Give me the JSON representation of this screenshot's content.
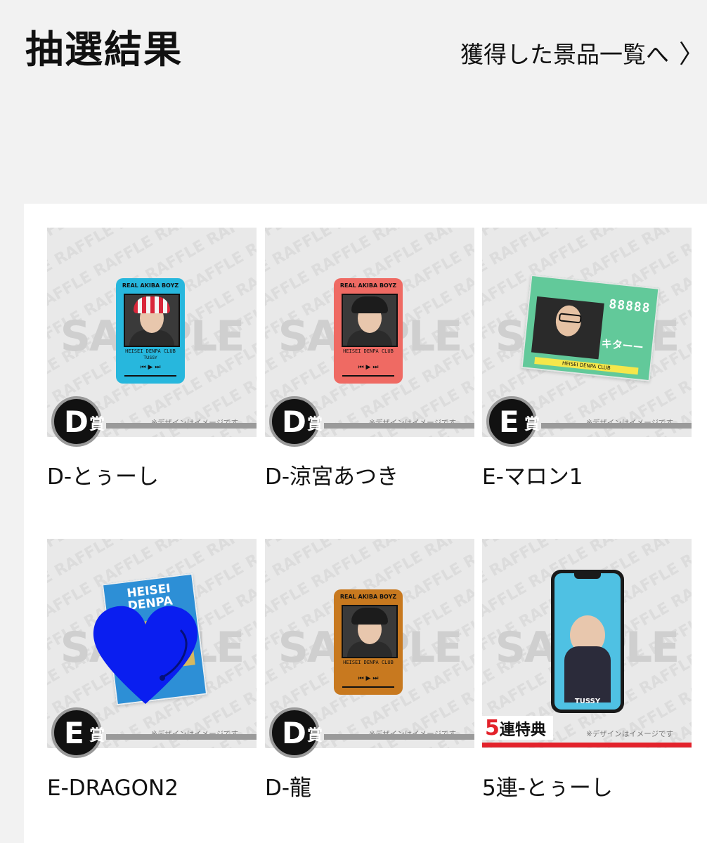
{
  "header": {
    "title": "抽選結果",
    "prizes_link": "獲得した景品一覧へ",
    "chevron_glyph": "〉"
  },
  "watermark": {
    "sample": "SAMPLE",
    "raffle": "RAFFLE"
  },
  "caution_text": "※デザインはイメージです",
  "prize_suffix": "賞",
  "items": [
    {
      "label": "D-とぅーし",
      "grade": "D",
      "product": "phone",
      "color": "#27b7dd",
      "hat": "#e8e8f0"
    },
    {
      "label": "D-涼宮あつき",
      "grade": "D",
      "product": "phone",
      "color": "#ef6a63",
      "hat": "#1c1c1c"
    },
    {
      "label": "E-マロン1",
      "grade": "E",
      "product": "ticket",
      "color": "#62c99a"
    },
    {
      "label": "E-DRAGON2",
      "grade": "E",
      "product": "book",
      "color": "#2d8fd6"
    },
    {
      "label": "D-龍",
      "grade": "D",
      "product": "phone",
      "color": "#c8791f",
      "hat": "#1c1c1c"
    },
    {
      "label": "5連-とぅーし",
      "grade": "",
      "product": "smartphone",
      "color": "#4fc1e3",
      "rensha_num": "5",
      "rensha_text": "連特典"
    }
  ],
  "product_text": {
    "header": "REAL AKIBA BOYZ",
    "club": "HEISEI DENPA CLUB",
    "controls": "⏮ ▶ ⏭",
    "ticket_digits": "88888",
    "ticket_name": "キターー",
    "book_title": "HEISEI DENPA",
    "phone_name": "TUSSY"
  },
  "overlay_colors": {
    "heart": "#0a1ef0",
    "rensha_red": "#e3222b"
  }
}
